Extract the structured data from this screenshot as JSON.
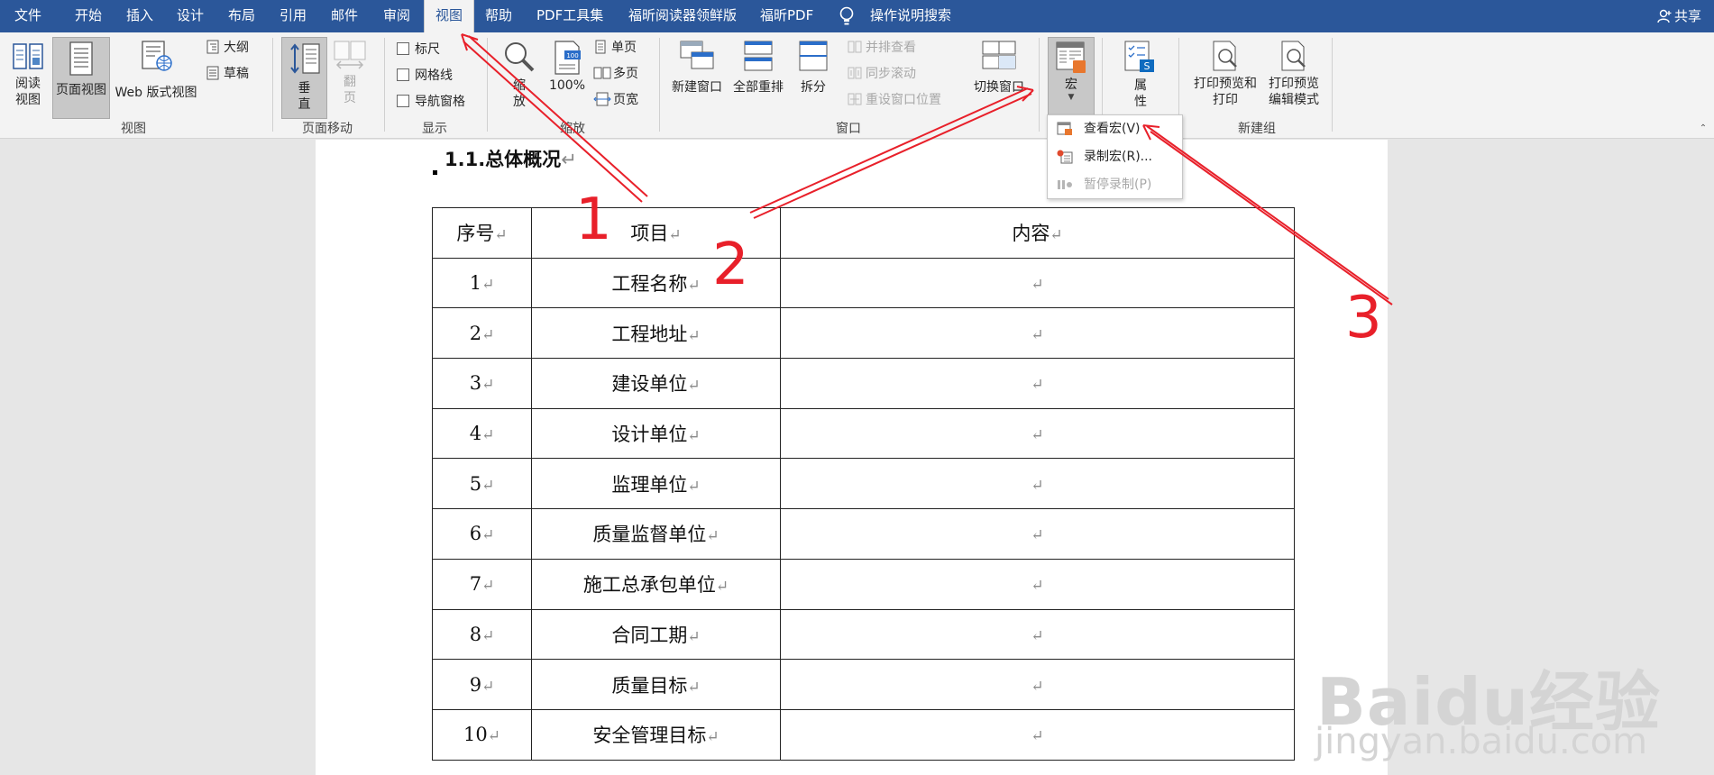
{
  "menubar": {
    "tabs": [
      "文件",
      "开始",
      "插入",
      "设计",
      "布局",
      "引用",
      "邮件",
      "审阅",
      "视图",
      "帮助",
      "PDF工具集",
      "福昕阅读器领鲜版",
      "福昕PDF"
    ],
    "active_tab": "视图",
    "tell_me": "操作说明搜索",
    "share": "共享"
  },
  "ribbon": {
    "views": {
      "read_mode": "阅读视图",
      "print_layout": "页面视图",
      "web_layout": "Web 版式视图",
      "outline": "大纲",
      "draft": "草稿",
      "group_label": "视图"
    },
    "page_movement": {
      "vertical": "垂直",
      "side_to_side": "翻页",
      "group_label": "页面移动"
    },
    "show": {
      "ruler": "标尺",
      "gridlines": "网格线",
      "nav_pane": "导航窗格",
      "group_label": "显示"
    },
    "zoom": {
      "zoom": "缩放",
      "hundred": "100%",
      "hundred_icon_text": "100",
      "one_page": "单页",
      "multi_page": "多页",
      "page_width": "页宽",
      "group_label": "缩放"
    },
    "window": {
      "new_window": "新建窗口",
      "arrange_all": "全部重排",
      "split": "拆分",
      "side_by_side": "并排查看",
      "sync_scroll": "同步滚动",
      "reset_position": "重设窗口位置",
      "switch_windows": "切换窗口",
      "group_label": "窗口"
    },
    "macros": {
      "label": "宏"
    },
    "properties": {
      "label": "属性"
    },
    "new_group": {
      "print_preview": "打印预览和打印",
      "print_preview_edit": "打印预览编辑模式",
      "group_label": "新建组"
    }
  },
  "macro_menu": {
    "view_macros": "查看宏(V)",
    "record_macro": "录制宏(R)...",
    "pause_recording": "暂停录制(P)"
  },
  "document": {
    "heading": "1.1.总体概况",
    "paragraph_mark": "↵",
    "table": {
      "headers": [
        "序号",
        "项目",
        "内容"
      ],
      "rows": [
        [
          "1",
          "工程名称",
          ""
        ],
        [
          "2",
          "工程地址",
          ""
        ],
        [
          "3",
          "建设单位",
          ""
        ],
        [
          "4",
          "设计单位",
          ""
        ],
        [
          "5",
          "监理单位",
          ""
        ],
        [
          "6",
          "质量监督单位",
          ""
        ],
        [
          "7",
          "施工总承包单位",
          ""
        ],
        [
          "8",
          "合同工期",
          ""
        ],
        [
          "9",
          "质量目标",
          ""
        ],
        [
          "10",
          "安全管理目标",
          ""
        ]
      ]
    }
  },
  "annotations": {
    "color": "#e8202a",
    "numbers": [
      "1",
      "2",
      "3"
    ]
  },
  "watermark": {
    "brand": "Baidu经验",
    "url": "jingyan.baidu.com"
  },
  "colors": {
    "accent": "#2b579a",
    "annotation": "#e8202a"
  }
}
